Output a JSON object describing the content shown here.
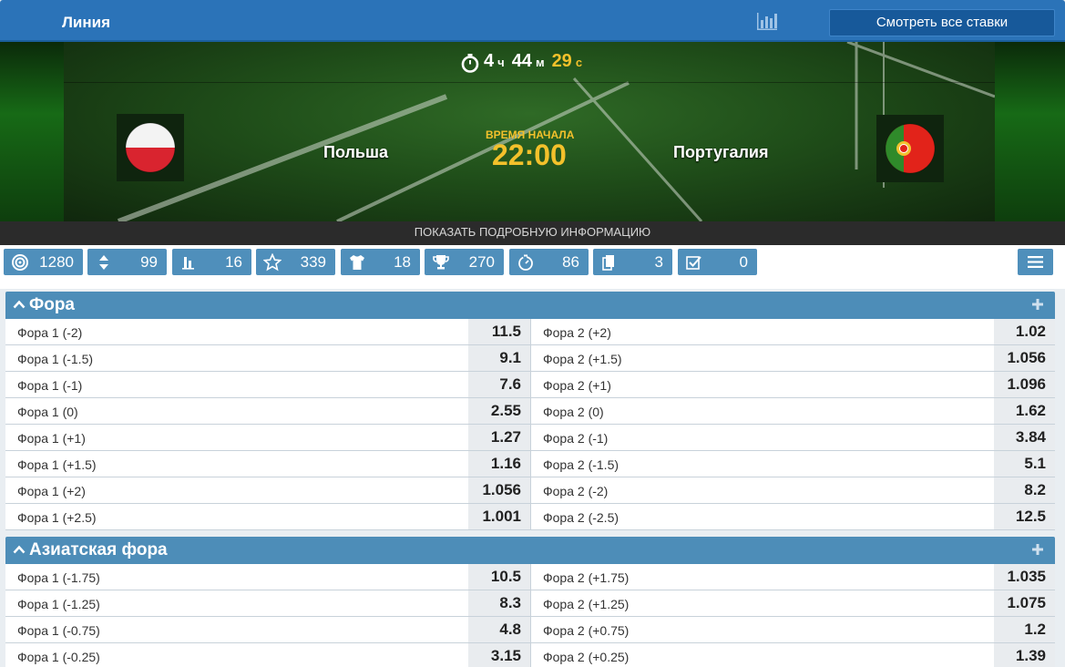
{
  "topbar": {
    "title": "Линия",
    "all_bets_label": "Смотреть все ставки",
    "stats_icon": "bar-chart-icon"
  },
  "hero": {
    "timer": {
      "hours": "4",
      "hours_unit": "ч",
      "minutes": "44",
      "minutes_unit": "м",
      "seconds": "29",
      "seconds_unit": "с"
    },
    "home_team": "Польша",
    "away_team": "Португалия",
    "start_label": "ВРЕМЯ НАЧАЛА",
    "start_time": "22:00",
    "info_link": "ПОКАЗАТЬ ПОДРОБНУЮ ИНФОРМАЦИЮ"
  },
  "filters": [
    {
      "icon": "target-icon",
      "count": "1280"
    },
    {
      "icon": "up-down-icon",
      "count": "99"
    },
    {
      "icon": "bars-icon",
      "count": "16"
    },
    {
      "icon": "star-icon",
      "count": "339"
    },
    {
      "icon": "shirt-icon",
      "count": "18"
    },
    {
      "icon": "trophy-icon",
      "count": "270"
    },
    {
      "icon": "stopwatch-icon",
      "count": "86"
    },
    {
      "icon": "cards-icon",
      "count": "3"
    },
    {
      "icon": "checkbox-icon",
      "count": "0"
    }
  ],
  "sections": [
    {
      "title": "Фора",
      "rows": [
        {
          "l1": "Фора 1 (-2)",
          "o1": "11.5",
          "l2": "Фора 2 (+2)",
          "o2": "1.02"
        },
        {
          "l1": "Фора 1 (-1.5)",
          "o1": "9.1",
          "l2": "Фора 2 (+1.5)",
          "o2": "1.056"
        },
        {
          "l1": "Фора 1 (-1)",
          "o1": "7.6",
          "l2": "Фора 2 (+1)",
          "o2": "1.096"
        },
        {
          "l1": "Фора 1 (0)",
          "o1": "2.55",
          "l2": "Фора 2 (0)",
          "o2": "1.62"
        },
        {
          "l1": "Фора 1 (+1)",
          "o1": "1.27",
          "l2": "Фора 2 (-1)",
          "o2": "3.84"
        },
        {
          "l1": "Фора 1 (+1.5)",
          "o1": "1.16",
          "l2": "Фора 2 (-1.5)",
          "o2": "5.1"
        },
        {
          "l1": "Фора 1 (+2)",
          "o1": "1.056",
          "l2": "Фора 2 (-2)",
          "o2": "8.2"
        },
        {
          "l1": "Фора 1 (+2.5)",
          "o1": "1.001",
          "l2": "Фора 2 (-2.5)",
          "o2": "12.5"
        }
      ]
    },
    {
      "title": "Азиатская фора",
      "rows": [
        {
          "l1": "Фора 1 (-1.75)",
          "o1": "10.5",
          "l2": "Фора 2 (+1.75)",
          "o2": "1.035"
        },
        {
          "l1": "Фора 1 (-1.25)",
          "o1": "8.3",
          "l2": "Фора 2 (+1.25)",
          "o2": "1.075"
        },
        {
          "l1": "Фора 1 (-0.75)",
          "o1": "4.8",
          "l2": "Фора 2 (+0.75)",
          "o2": "1.2"
        },
        {
          "l1": "Фора 1 (-0.25)",
          "o1": "3.15",
          "l2": "Фора 2 (+0.25)",
          "o2": "1.39"
        }
      ]
    }
  ],
  "colors": {
    "primary": "#2b73b8",
    "accent": "#f3c12b",
    "section": "#4d8db8",
    "filter": "#4f8fbb"
  }
}
